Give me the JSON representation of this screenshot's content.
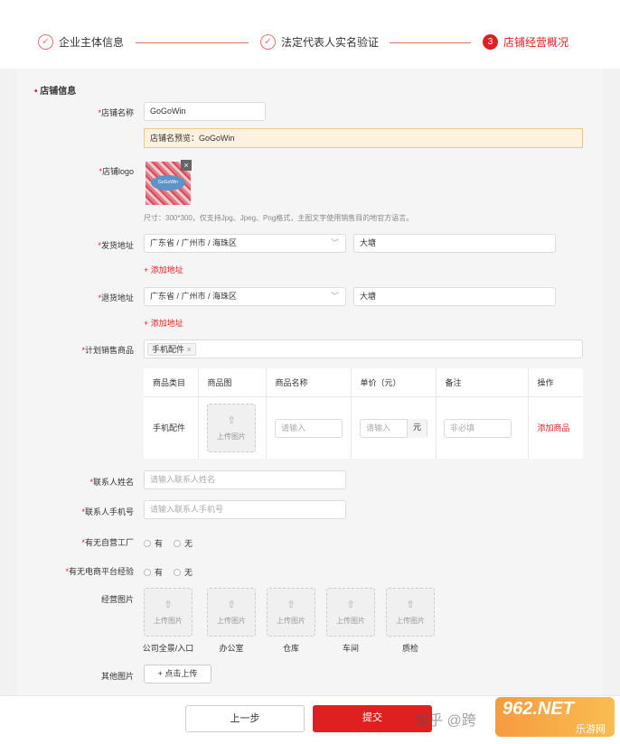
{
  "steps": [
    {
      "label": "企业主体信息",
      "state": "done"
    },
    {
      "label": "法定代表人实名验证",
      "state": "done"
    },
    {
      "num": "3",
      "label": "店铺经营概况",
      "state": "active"
    }
  ],
  "section_title": "店铺信息",
  "store_name": {
    "label": "店铺名称",
    "value": "GoGoWin"
  },
  "preview": {
    "text": "店铺名预览：GoGoWin"
  },
  "logo": {
    "label": "店铺logo",
    "logo_text": "GoGoWin",
    "close": "×",
    "hint": "尺寸：300*300，仅支持Jpg、Jpeg、Png格式，主图文字使用销售目的地官方语言。"
  },
  "ship_addr": {
    "label": "发货地址",
    "region": "广东省 / 广州市 / 海珠区",
    "detail": "大塘",
    "add": "+ 添加地址"
  },
  "return_addr": {
    "label": "退货地址",
    "region": "广东省 / 广州市 / 海珠区",
    "detail": "大塘",
    "add": "+ 添加地址"
  },
  "planned": {
    "label": "计划销售商品",
    "tag": "手机配件",
    "tag_close": "×"
  },
  "table": {
    "headers": [
      "商品类目",
      "商品图",
      "商品名称",
      "单价（元）",
      "备注",
      "操作"
    ],
    "row": {
      "category": "手机配件",
      "upload": "上传图片",
      "name_ph": "请输入",
      "price_ph": "请输入",
      "unit": "元",
      "note_ph": "非必填",
      "action": "添加商品"
    }
  },
  "contact_name": {
    "label": "联系人姓名",
    "placeholder": "请输入联系人姓名"
  },
  "contact_phone": {
    "label": "联系人手机号",
    "placeholder": "请输入联系人手机号"
  },
  "factory": {
    "label": "有无自营工厂",
    "yes": "有",
    "no": "无"
  },
  "ecom": {
    "label": "有无电商平台经验",
    "yes": "有",
    "no": "无"
  },
  "ops_images": {
    "label": "经营图片",
    "upload": "上传图片",
    "captions": [
      "公司全景/入口",
      "办公室",
      "仓库",
      "车间",
      "质检"
    ]
  },
  "other_images": {
    "label": "其他图片",
    "button": "+ 点击上传"
  },
  "buttons": {
    "prev": "上一步",
    "submit": "提交"
  },
  "watermark": {
    "zhihu": "知乎 @跨",
    "site": "962.NET",
    "site_sub": "乐游网"
  },
  "colors": {
    "accent": "#e02020",
    "step_line": "#e3736a"
  }
}
